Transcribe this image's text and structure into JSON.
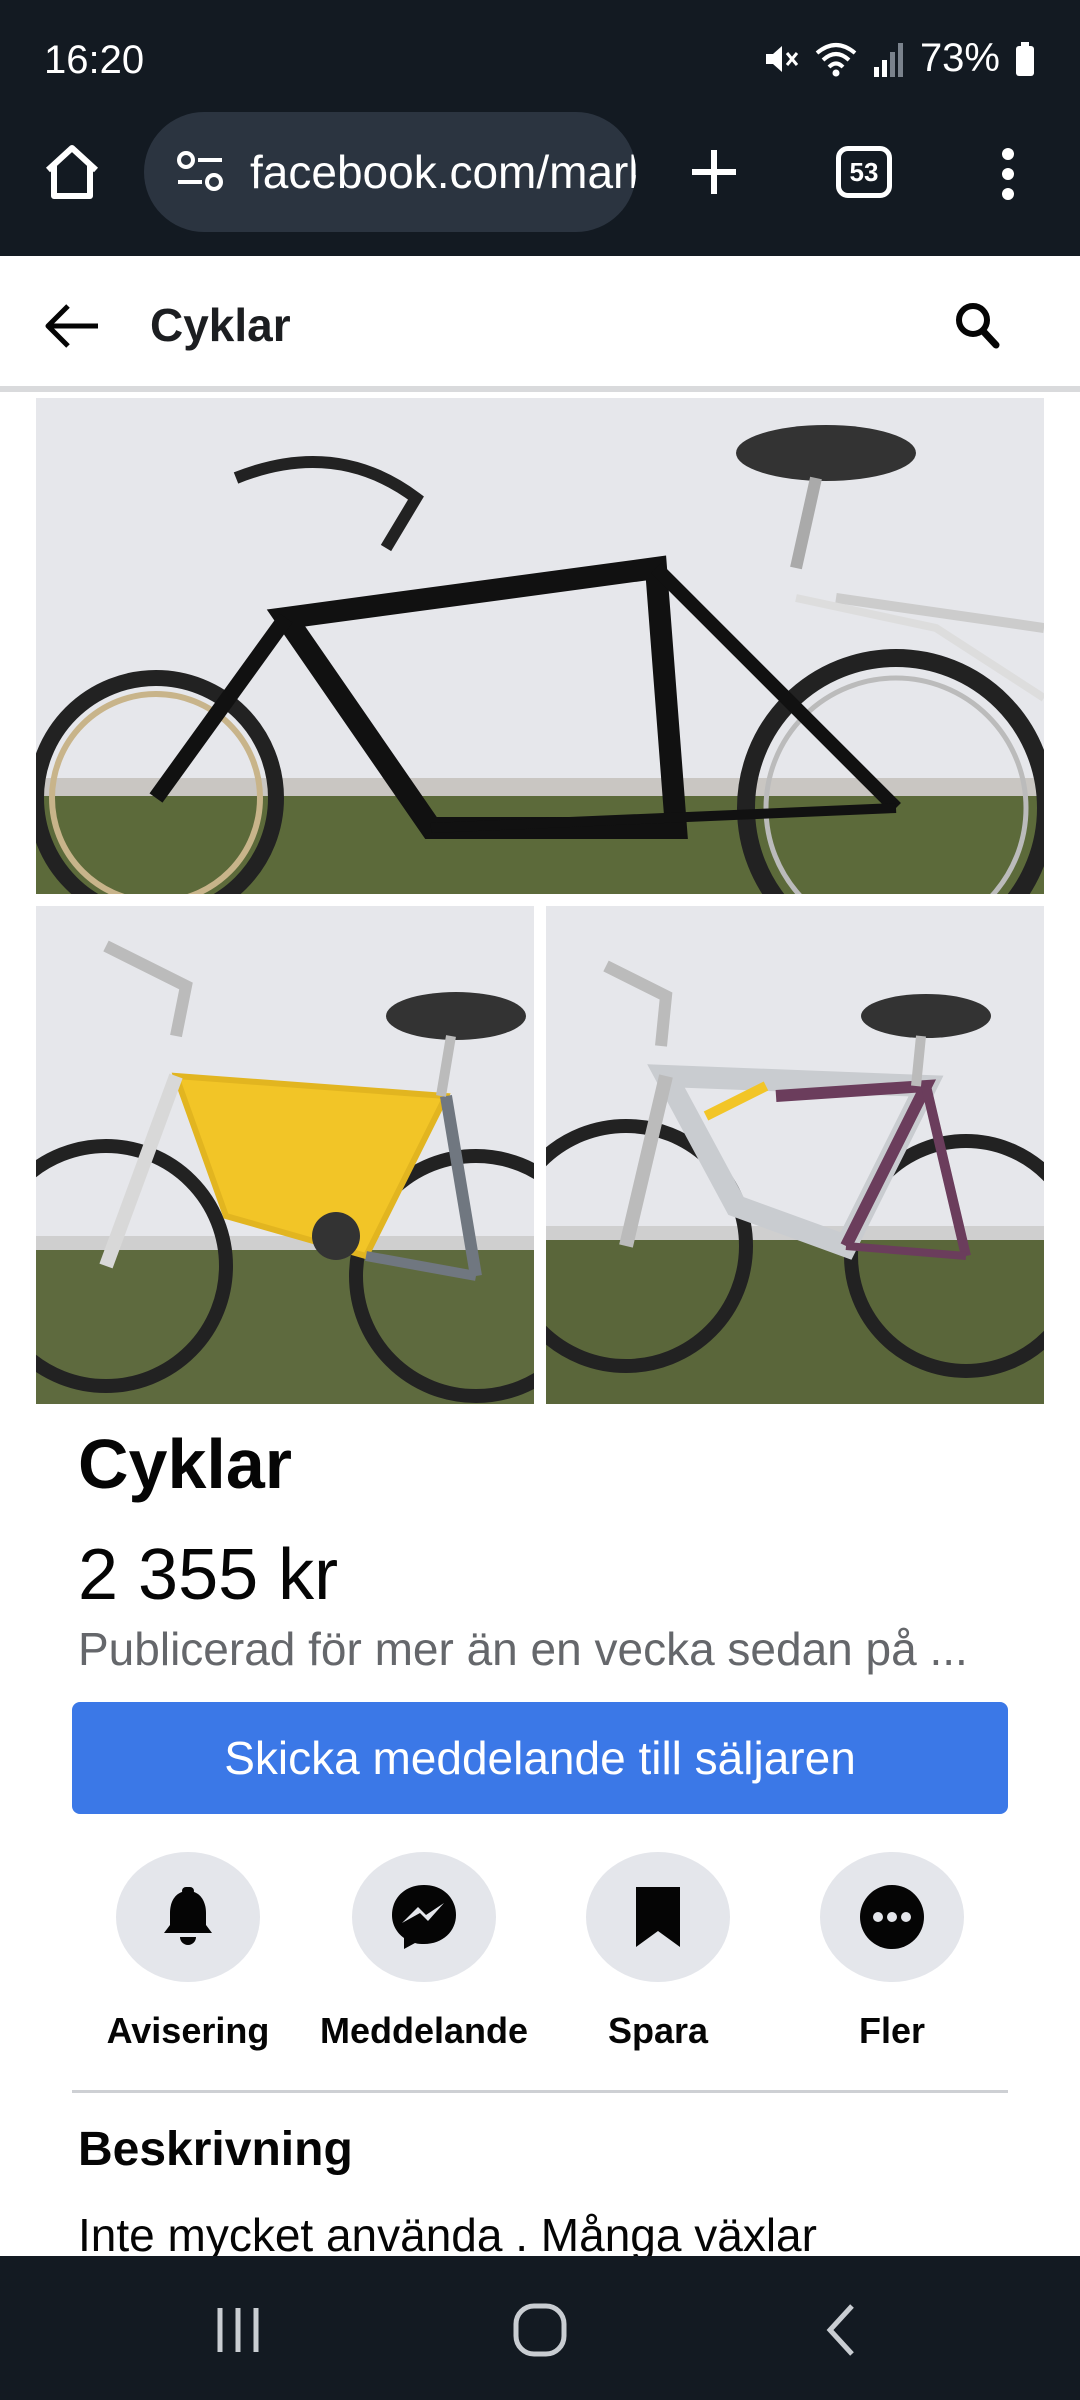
{
  "status_bar": {
    "time": "16:20",
    "battery": "73%",
    "icons": [
      "mute-icon",
      "wifi-icon",
      "signal-icon",
      "battery-icon"
    ]
  },
  "browser": {
    "url": "facebook.com/marketplace",
    "tab_count": "53",
    "icons": [
      "home-icon",
      "site-settings-icon",
      "plus-icon",
      "more-vert-icon"
    ]
  },
  "header": {
    "title": "Cyklar",
    "icons": [
      "back-arrow-icon",
      "search-icon"
    ]
  },
  "photos": [
    {
      "name": "black-bicycle-photo"
    },
    {
      "name": "yellow-bicycle-photo"
    },
    {
      "name": "purple-bicycle-photo"
    }
  ],
  "listing": {
    "title": "Cyklar",
    "price": "2 355 kr",
    "meta": "Publicerad för mer än en vecka sedan på ...",
    "message_seller_label": "Skicka meddelande till säljaren"
  },
  "actions": [
    {
      "label": "Avisering",
      "icon": "bell-icon"
    },
    {
      "label": "Meddelande",
      "icon": "messenger-icon"
    },
    {
      "label": "Spara",
      "icon": "bookmark-icon"
    },
    {
      "label": "Fler",
      "icon": "more-horizontal-icon"
    }
  ],
  "description": {
    "heading": "Beskrivning",
    "text": "Inte mycket använda . Många växlar"
  },
  "nav": {
    "icons": [
      "recents-icon",
      "home-circle-icon",
      "back-chevron-icon"
    ]
  },
  "colors": {
    "chrome_bg": "#131a22",
    "url_bar_bg": "#2b3440",
    "primary_button": "#3b78e7",
    "action_circle": "#e4e6eb",
    "meta_text": "#65676b"
  }
}
